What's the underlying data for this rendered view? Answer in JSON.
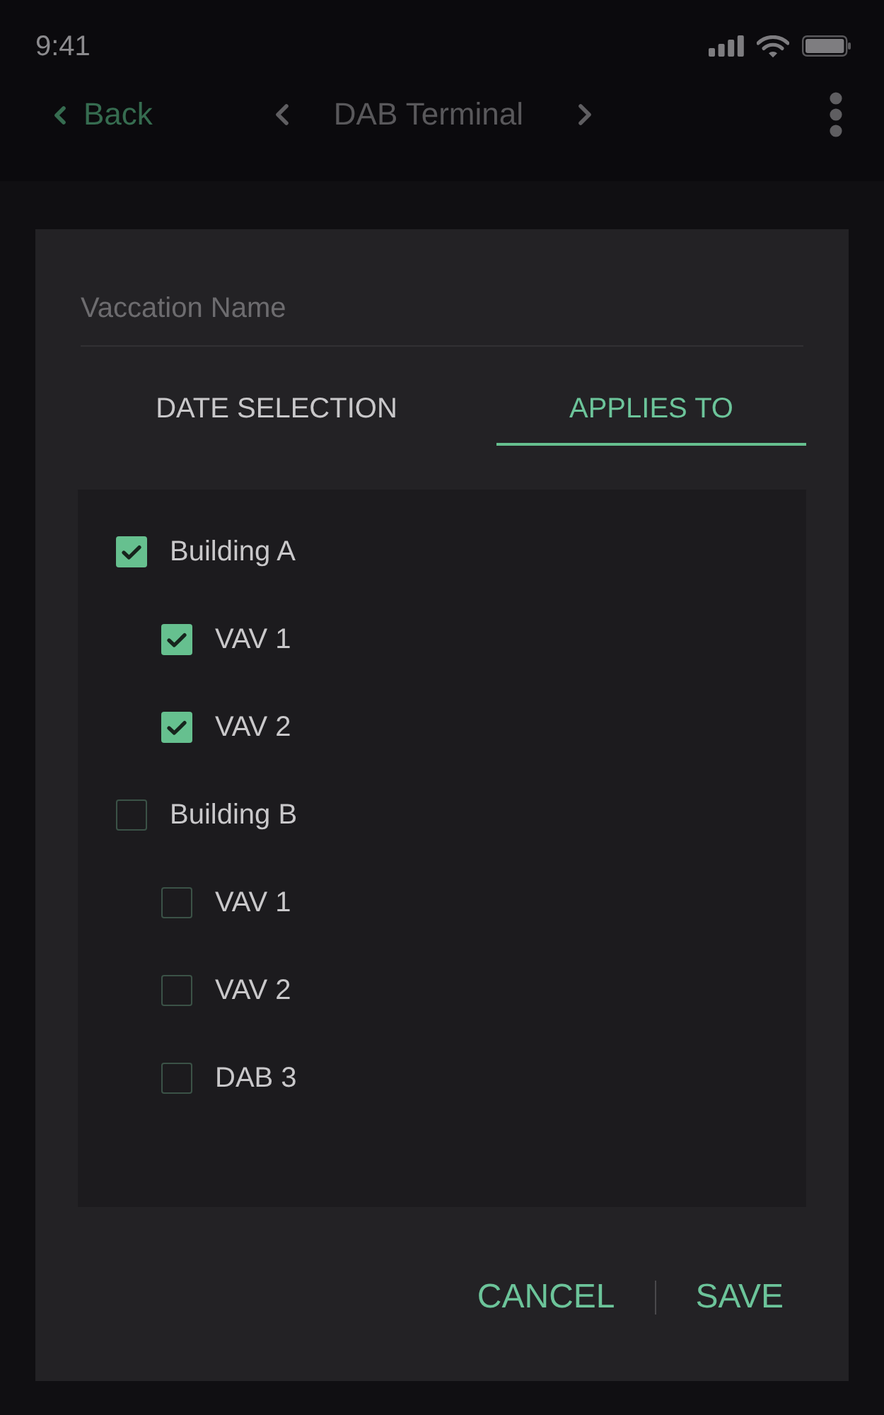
{
  "status_bar": {
    "time": "9:41"
  },
  "nav_bar": {
    "back": "Back",
    "title": "DAB Terminal"
  },
  "dialog": {
    "name_field": {
      "placeholder": "Vaccation Name"
    },
    "tabs": [
      {
        "label": "DATE SELECTION",
        "selected": false
      },
      {
        "label": "APPLIES TO",
        "selected": true
      }
    ],
    "tree": [
      {
        "label": "Building A",
        "checked": true,
        "children": [
          {
            "label": "VAV 1",
            "checked": true
          },
          {
            "label": "VAV 2",
            "checked": true
          }
        ]
      },
      {
        "label": "Building B",
        "checked": false,
        "children": [
          {
            "label": "VAV 1",
            "checked": false
          },
          {
            "label": "VAV 2",
            "checked": false
          },
          {
            "label": "DAB 3",
            "checked": false
          }
        ]
      }
    ],
    "buttons": [
      "CANCEL",
      "SAVE"
    ]
  }
}
